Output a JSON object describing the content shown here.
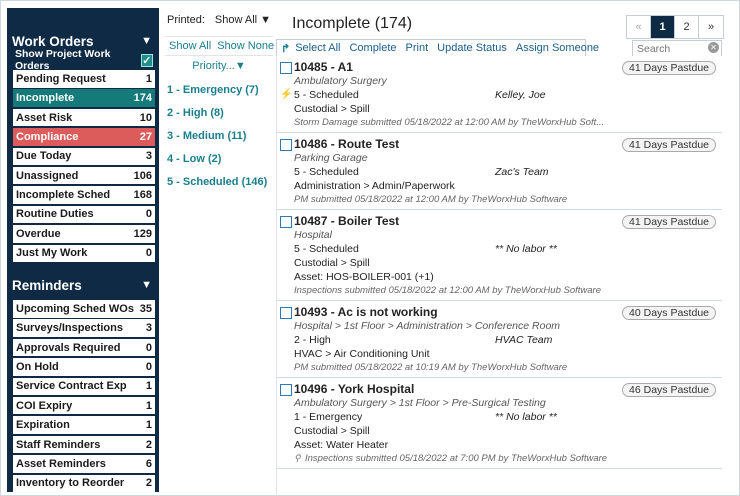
{
  "sidebar": {
    "work_orders": {
      "title": "Work Orders",
      "show_project_label": "Show Project Work Orders",
      "items": [
        {
          "label": "Pending Request",
          "count": "1"
        },
        {
          "label": "Incomplete",
          "count": "174"
        },
        {
          "label": "Asset Risk",
          "count": "10"
        },
        {
          "label": "Compliance",
          "count": "27"
        },
        {
          "label": "Due Today",
          "count": "3"
        },
        {
          "label": "Unassigned",
          "count": "106"
        },
        {
          "label": "Incomplete Sched",
          "count": "168"
        },
        {
          "label": "Routine Duties",
          "count": "0"
        },
        {
          "label": "Overdue",
          "count": "129"
        },
        {
          "label": "Just My Work",
          "count": "0"
        }
      ]
    },
    "reminders": {
      "title": "Reminders",
      "items": [
        {
          "label": "Upcoming Sched WOs",
          "count": "35"
        },
        {
          "label": "Surveys/Inspections",
          "count": "3"
        },
        {
          "label": "Approvals Required",
          "count": "0"
        },
        {
          "label": "On Hold",
          "count": "0"
        },
        {
          "label": "Service Contract Exp",
          "count": "1"
        },
        {
          "label": "COI Expiry",
          "count": "1"
        },
        {
          "label": "Expiration",
          "count": "1"
        },
        {
          "label": "Staff Reminders",
          "count": "2"
        },
        {
          "label": "Asset Reminders",
          "count": "6"
        },
        {
          "label": "Inventory to Reorder",
          "count": "2"
        }
      ]
    },
    "arrow": "▼",
    "check": "✓"
  },
  "filters": {
    "printed_label": "Printed:",
    "printed_value": "Show All ▼",
    "show_all": "Show All",
    "show_none": "Show None",
    "priority_header": "Priority...▼",
    "priorities": [
      "1 - Emergency (7)",
      "2 - High (8)",
      "3 - Medium (11)",
      "4 - Low (2)",
      "5 - Scheduled (146)"
    ]
  },
  "main": {
    "title": "Incomplete (174)",
    "pager": {
      "prev": "«",
      "page1": "1",
      "page2": "2",
      "next": "»"
    },
    "actions": {
      "sort_icon": "↱",
      "select_all": "Select All",
      "complete": "Complete",
      "print": "Print",
      "update_status": "Update Status",
      "assign": "Assign Someone"
    },
    "search_placeholder": "Search",
    "search_clear": "✕",
    "cards": [
      {
        "wo": "10485 - A1",
        "location": "Ambulatory Surgery",
        "status": "5 - Scheduled",
        "assignee": "Kelley, Joe",
        "category": "Custodial > Spill",
        "submitted": "Storm Damage submitted 05/18/2022 at 12:00 AM by TheWorxHub Soft...",
        "badge": "41 Days Pastdue"
      },
      {
        "wo": "10486 - Route Test",
        "location": "Parking Garage",
        "status": "5 - Scheduled",
        "assignee": "Zac's Team",
        "category": "Administration > Admin/Paperwork",
        "submitted": "PM submitted 05/18/2022 at 12:00 AM by TheWorxHub Software",
        "badge": "41 Days Pastdue"
      },
      {
        "wo": "10487 - Boiler Test",
        "location": "Hospital",
        "status": "5 - Scheduled",
        "assignee": "** No labor **",
        "category": "Custodial > Spill",
        "asset": "Asset: HOS-BOILER-001 (+1)",
        "submitted": "Inspections submitted 05/18/2022 at 12:00 AM by TheWorxHub Software",
        "badge": "41 Days Pastdue"
      },
      {
        "wo": "10493 - Ac is not working",
        "location": "Hospital > 1st Floor > Administration > Conference Room",
        "status": "2 - High",
        "assignee": "HVAC Team",
        "category": "HVAC > Air Conditioning Unit",
        "submitted": "PM submitted 05/18/2022 at 10:19 AM by TheWorxHub Software",
        "badge": "40 Days Pastdue"
      },
      {
        "wo": "10496 - York Hospital",
        "location": "Ambulatory Surgery > 1st Floor > Pre-Surgical Testing",
        "status": "1 - Emergency",
        "assignee": "** No labor **",
        "category": "Custodial > Spill",
        "asset": "Asset: Water Heater",
        "submitted": "Inspections submitted 05/18/2022 at 7:00 PM by TheWorxHub Software",
        "badge": "46 Days Pastdue"
      }
    ],
    "bolt_icon": "⚡",
    "pin_icon": "⚲"
  }
}
